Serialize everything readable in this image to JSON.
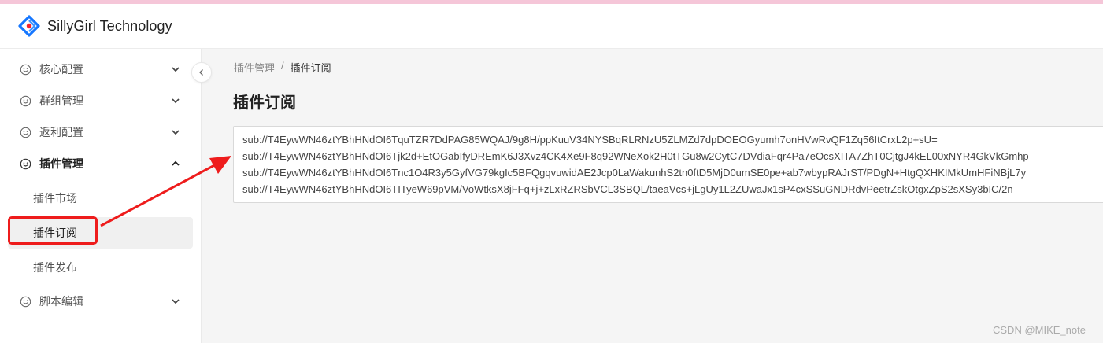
{
  "header": {
    "app_title": "SillyGirl Technology"
  },
  "sidebar": {
    "menus": [
      {
        "label": "核心配置",
        "chevron": "down"
      },
      {
        "label": "群组管理",
        "chevron": "down"
      },
      {
        "label": "返利配置",
        "chevron": "down"
      },
      {
        "label": "插件管理",
        "chevron": "up"
      },
      {
        "label": "脚本编辑",
        "chevron": "down"
      }
    ],
    "plugin_submenu": [
      {
        "label": "插件市场"
      },
      {
        "label": "插件订阅"
      },
      {
        "label": "插件发布"
      }
    ]
  },
  "breadcrumb": {
    "parent": "插件管理",
    "separator": "/",
    "current": "插件订阅"
  },
  "page": {
    "title": "插件订阅"
  },
  "subscriptions": [
    "sub://T4EywWN46ztYBhHNdOI6TquTZR7DdPAG85WQAJ/9g8H/ppKuuV34NYSBqRLRNzU5ZLMZd7dpDOEOGyumh7onHVwRvQF1Zq56ItCrxL2p+sU=",
    "sub://T4EywWN46ztYBhHNdOI6Tjk2d+EtOGabIfyDREmK6J3Xvz4CK4Xe9F8q92WNeXok2H0tTGu8w2CytC7DVdiaFqr4Pa7eOcsXITA7ZhT0CjtgJ4kEL00xNYR4GkVkGmhp",
    "sub://T4EywWN46ztYBhHNdOI6Tnc1O4R3y5GyfVG79kgIc5BFQgqvuwidAE2Jcp0LaWakunhS2tn0ftD5MjD0umSE0pe+ab7wbypRAJrST/PDgN+HtgQXHKIMkUmHFiNBjL7y",
    "sub://T4EywWN46ztYBhHNdOI6TITyeW69pVM/VoWtksX8jFFq+j+zLxRZRSbVCL3SBQL/taeaVcs+jLgUy1L2ZUwaJx1sP4cxSSuGNDRdvPeetrZskOtgxZpS2sXSy3bIC/2n"
  ],
  "watermark": "CSDN @MIKE_note",
  "colors": {
    "accent_red": "#ee1c1c",
    "logo_blue": "#1677ff",
    "logo_red": "#f5222d"
  }
}
